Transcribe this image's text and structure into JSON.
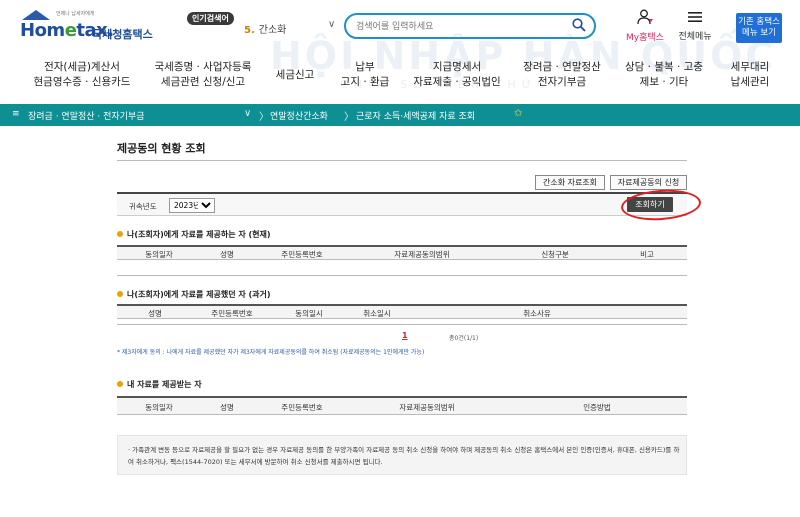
{
  "header": {
    "logo_tagline": "언제나 납세자에게",
    "logo_home": "Hom",
    "logo_e": "e",
    "logo_tax": "tax.",
    "logo_kr": "국세청홈택스",
    "popular_label": "인기검색어",
    "popular_rank": "5.",
    "popular_term": "간소화",
    "search_placeholder": "검색어를 입력하세요",
    "my_home_label": "My홈택스",
    "all_menu_label": "전체메뉴",
    "old_home_line1": "기존 홈택스",
    "old_home_line2": "메뉴 보기"
  },
  "gnb": [
    {
      "line1": "전자(세금)계산서",
      "line2": "현금영수증 · 신용카드"
    },
    {
      "line1": "국세증명 · 사업자등록",
      "line2": "세금관련 신청/신고"
    },
    {
      "line1": "세금신고",
      "line2": ""
    },
    {
      "line1": "납부",
      "line2": "고지 · 환급"
    },
    {
      "line1": "지급명세서",
      "line2": "자료제출 · 공익법인"
    },
    {
      "line1": "장려금 · 연말정산",
      "line2": "전자기부금"
    },
    {
      "line1": "상담 · 불복 · 고충",
      "line2": "제보 · 기타"
    },
    {
      "line1": "세무대리",
      "line2": "납세관리"
    }
  ],
  "watermark": {
    "main": "HỘI NHẬP HÀN QUỐC",
    "sub": "CHIA SẺ KIẾN THỨC"
  },
  "breadcrumb": {
    "menu": "≡",
    "level1": "장려금 · 연말정산 · 전자기부금",
    "level2": "연말정산간소화",
    "level3": "근로자 소득·세액공제 자료 조회",
    "star": "✩"
  },
  "page": {
    "title": "제공동의 현황 조회",
    "btn_simplified": "간소화 자료조회",
    "btn_consent": "자료제공동의 신청",
    "year_label": "귀속년도",
    "year_value": "2023년",
    "query_button": "조회하기"
  },
  "section1": {
    "title": "나(조회자)에게 자료를 제공하는 자 (현재)",
    "columns": [
      "동의일자",
      "성명",
      "주민등록번호",
      "자료제공동의범위",
      "신청구분",
      "비고"
    ]
  },
  "section2": {
    "title": "나(조회자)에게 자료를 제공했던 자 (과거)",
    "columns": [
      "성명",
      "주민등록번호",
      "동의일시",
      "취소일시",
      "취소사유"
    ],
    "page_number": "1",
    "page_count": "총0건(1/1)",
    "note": "* 제3자에게 동의 : 나에게 자료를 제공했던 자가 제3자에게 자료제공동의를 하여 취소됨 (자료제공동의는 1인에게만 가능)"
  },
  "section3": {
    "title": "내 자료를 제공받는 자",
    "columns": [
      "동의일자",
      "성명",
      "주민등록번호",
      "자료제공동의범위",
      "인증방법"
    ]
  },
  "info": {
    "text": "· 가족관계 변동 등으로 자료제공을 할 필요가 없는 경우 자료제공 동의를 한 부양가족이 자료제공 동의 취소 신청을 하여야 하며 제공동의 취소 신청은 홈택스에서 본인 인증(인증서, 휴대폰, 신용카드)를 하여 취소하거나, 팩스(1544-7020) 또는 세무서에 방문하여 취소 신청서를 제출하시면 됩니다."
  },
  "colors": {
    "accent": "#1f8fc9",
    "crumb_bar": "#0d8f94",
    "annotation": "#e02020",
    "bullet": "#f0a000",
    "my_home": "#e0245e"
  }
}
